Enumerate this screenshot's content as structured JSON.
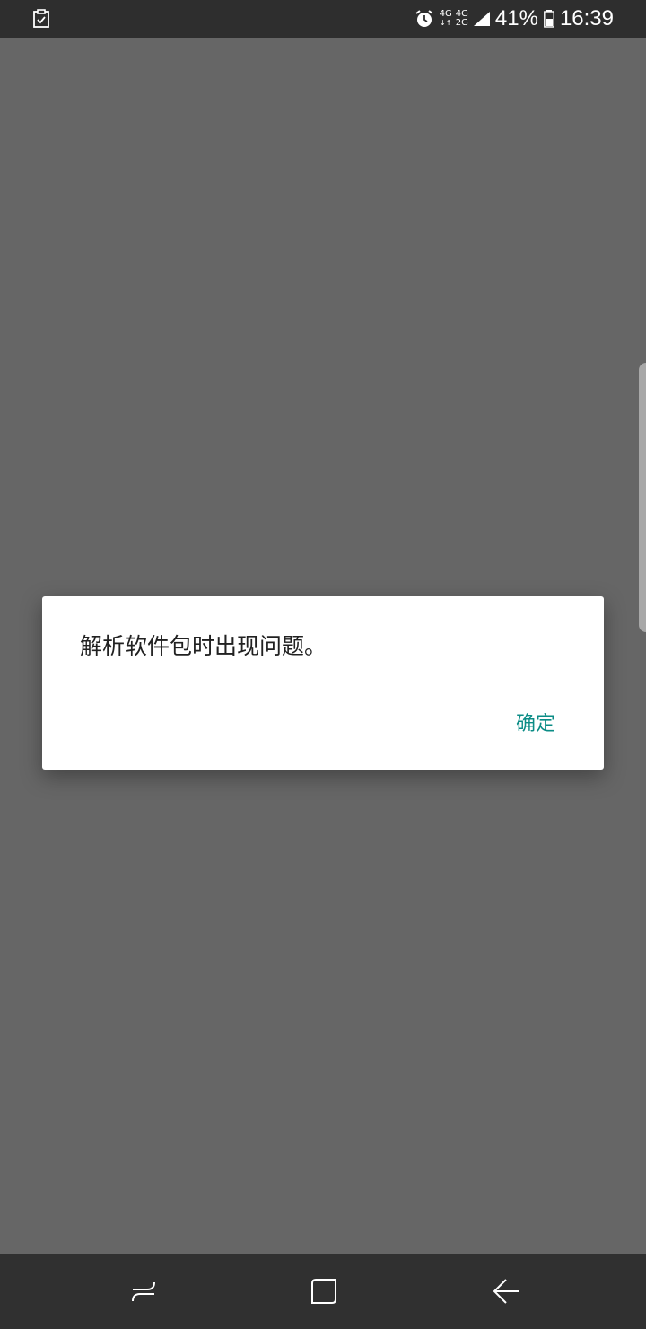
{
  "status_bar": {
    "left_icon": "task-checkbox-icon",
    "alarm_icon": "alarm-clock-icon",
    "network_1": "4G",
    "network_2_top": "4G",
    "network_2_bottom": "2G",
    "signal_icon": "signal-bars-icon",
    "battery_percent": "41%",
    "battery_icon": "battery-icon",
    "time": "16:39"
  },
  "dialog": {
    "message": "解析软件包时出现问题。",
    "ok_label": "确定",
    "ok_color": "#0b8c86"
  },
  "nav_bar": {
    "recents_icon": "recents-icon",
    "home_icon": "home-icon",
    "back_icon": "back-arrow-icon"
  },
  "colors": {
    "scrim": "#666666",
    "status_bar": "#2e2e2e",
    "nav_bar": "#303030"
  }
}
